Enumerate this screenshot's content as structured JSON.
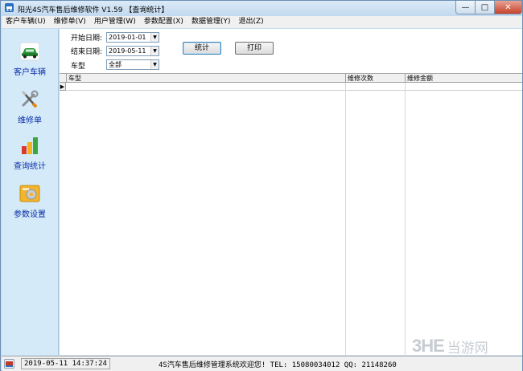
{
  "window": {
    "title": "阳光4S汽车售后维修软件 V1.59 【查询统计】",
    "minimize": "—",
    "maximize": "□",
    "close": "✕"
  },
  "menu": [
    "客户车辆(U)",
    "维修单(V)",
    "用户管理(W)",
    "参数配置(X)",
    "数据管理(Y)",
    "退出(Z)"
  ],
  "nav": [
    {
      "label": "客户车辆",
      "icon": "car-icon"
    },
    {
      "label": "维修单",
      "icon": "tools-icon"
    },
    {
      "label": "查询统计",
      "icon": "chart-icon"
    },
    {
      "label": "参数设置",
      "icon": "settings-icon"
    }
  ],
  "filters": {
    "start_label": "开始日期:",
    "start_value": "2019-01-01",
    "end_label": "结束日期:",
    "end_value": "2019-05-11",
    "type_label": "车型",
    "type_value": "全部"
  },
  "buttons": {
    "stat": "统计",
    "print": "打印"
  },
  "grid": {
    "columns": [
      "车型",
      "维修次数",
      "维修金额"
    ],
    "current_row_marker": "▶"
  },
  "status": {
    "time": "2019-05-11 14:37:24",
    "message": "4S汽车售后维修管理系统欢迎您!  TEL: 15080034012 QQ: 21148260"
  },
  "watermark": {
    "logo": "3HE",
    "text": "当游网"
  },
  "colors": {
    "nav_label": "#0a2ea8",
    "nav_bg": "#d5eaf8",
    "close_button": "#c7412b"
  }
}
